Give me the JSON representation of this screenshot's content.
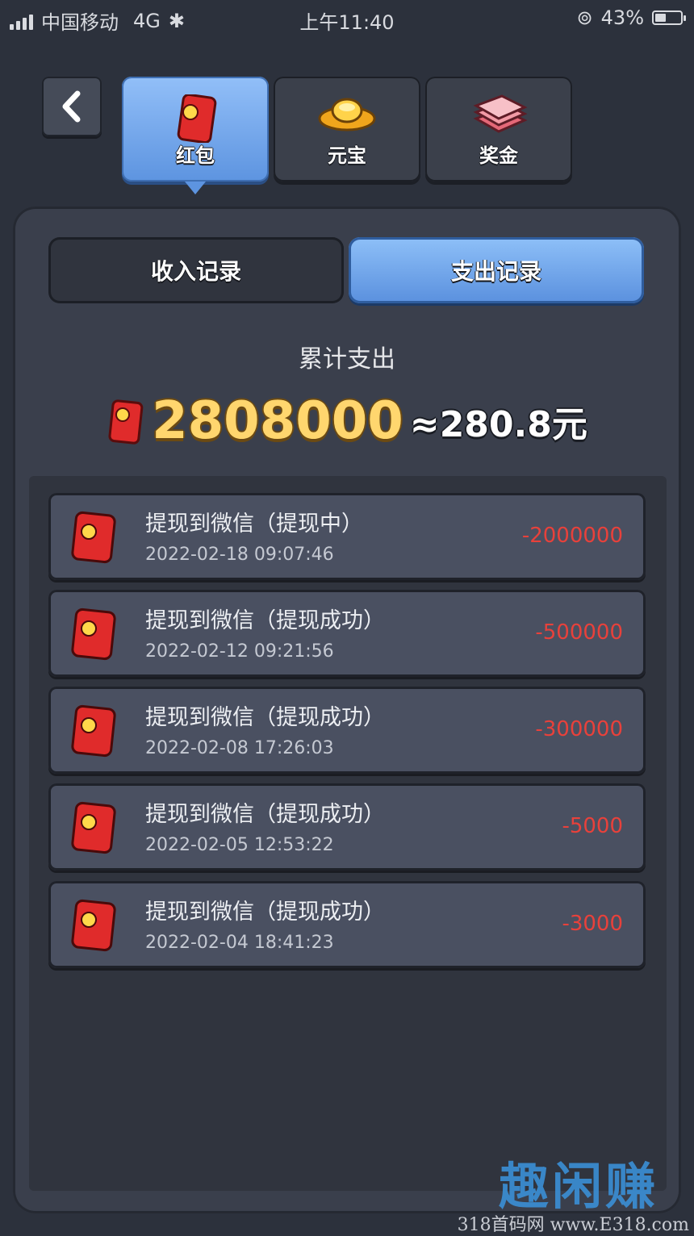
{
  "status_bar": {
    "carrier": "中国移动",
    "network": "4G",
    "time": "上午11:40",
    "battery": "43%",
    "battery_level": 0.43
  },
  "top_tabs": [
    {
      "label": "红包",
      "icon": "red-envelope-icon",
      "active": true
    },
    {
      "label": "元宝",
      "icon": "gold-ingot-icon",
      "active": false
    },
    {
      "label": "奖金",
      "icon": "cash-stack-icon",
      "active": false
    }
  ],
  "sub_tabs": [
    {
      "label": "收入记录",
      "active": false
    },
    {
      "label": "支出记录",
      "active": true
    }
  ],
  "summary": {
    "label": "累计支出",
    "amount": "2808000",
    "yuan": "≈280.8元"
  },
  "records": [
    {
      "title": "提现到微信（提现中）",
      "time": "2022-02-18 09:07:46",
      "amount": "-2000000"
    },
    {
      "title": "提现到微信（提现成功）",
      "time": "2022-02-12 09:21:56",
      "amount": "-500000"
    },
    {
      "title": "提现到微信（提现成功）",
      "time": "2022-02-08 17:26:03",
      "amount": "-300000"
    },
    {
      "title": "提现到微信（提现成功）",
      "time": "2022-02-05 12:53:22",
      "amount": "-5000"
    },
    {
      "title": "提现到微信（提现成功）",
      "time": "2022-02-04 18:41:23",
      "amount": "-3000"
    }
  ],
  "watermark": {
    "logo": "趣闲赚",
    "url": "318首码网 www.E318.com"
  },
  "colors": {
    "accent_blue": "#5d94e0",
    "amount_red": "#e8413b",
    "gold": "#ffd66e"
  }
}
